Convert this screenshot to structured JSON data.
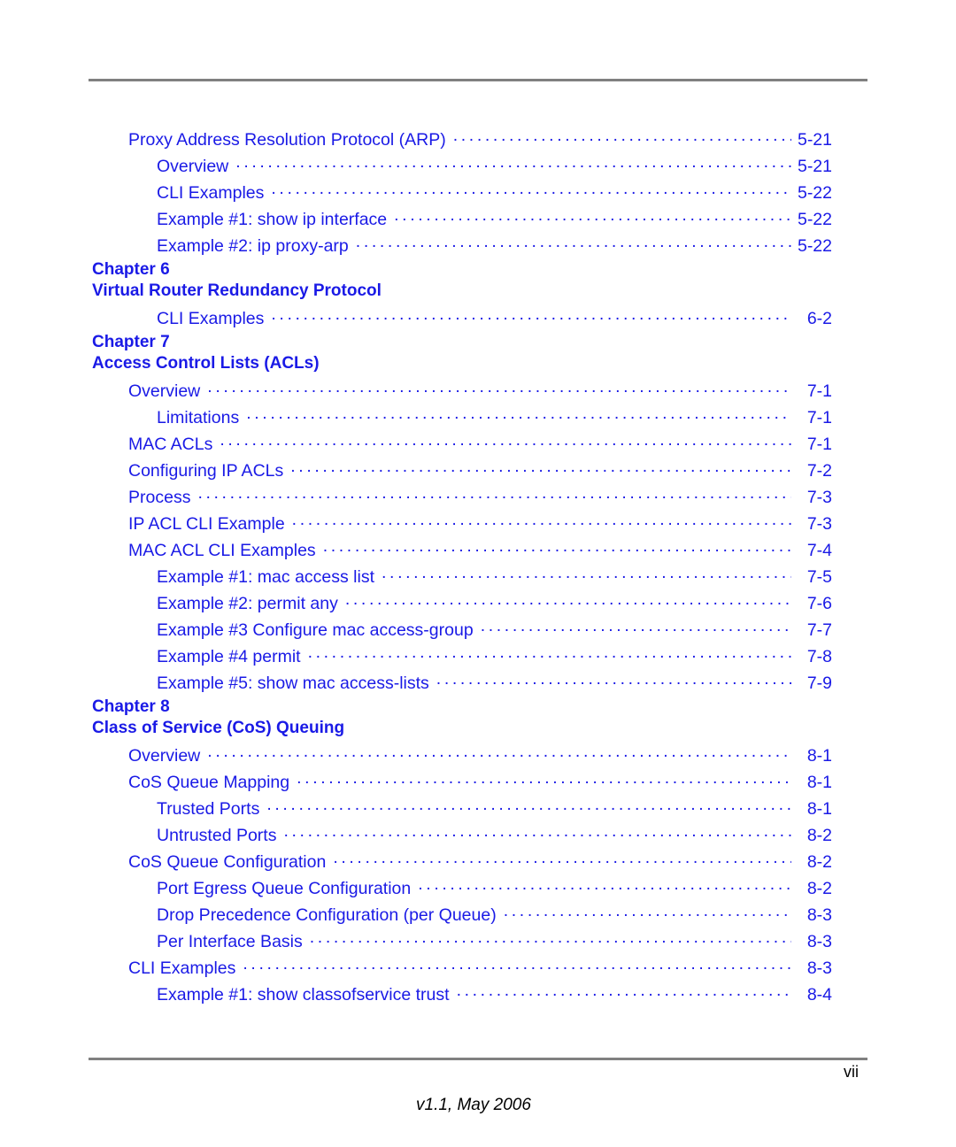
{
  "document": {
    "footer_page_number": "vii",
    "footer_version": "v1.1, May 2006",
    "accent_color": "#1a1ae6",
    "rule_color": "#808080"
  },
  "toc": {
    "blocks": [
      {
        "kind": "entries",
        "entries": [
          {
            "level": 1,
            "label": "Proxy Address Resolution Protocol (ARP)",
            "page": "5-21"
          },
          {
            "level": 2,
            "label": "Overview",
            "page": "5-21"
          },
          {
            "level": 2,
            "label": "CLI Examples",
            "page": "5-22"
          },
          {
            "level": 3,
            "label": "Example #1: show ip interface",
            "page": "5-22"
          },
          {
            "level": 3,
            "label": "Example #2: ip proxy-arp",
            "page": "5-22"
          }
        ]
      },
      {
        "kind": "chapter",
        "number": "Chapter 6",
        "title": "Virtual Router Redundancy Protocol",
        "entries": [
          {
            "level": 2,
            "label": "CLI Examples",
            "page": "6-2"
          }
        ]
      },
      {
        "kind": "chapter",
        "number": "Chapter 7",
        "title": "Access Control Lists (ACLs)",
        "entries": [
          {
            "level": 1,
            "label": "Overview",
            "page": "7-1"
          },
          {
            "level": 2,
            "label": "Limitations",
            "page": "7-1"
          },
          {
            "level": 1,
            "label": "MAC ACLs",
            "page": "7-1"
          },
          {
            "level": 1,
            "label": "Configuring IP ACLs",
            "page": "7-2"
          },
          {
            "level": 1,
            "label": "Process",
            "page": "7-3"
          },
          {
            "level": 1,
            "label": "IP ACL CLI Example",
            "page": "7-3"
          },
          {
            "level": 1,
            "label": "MAC ACL CLI Examples",
            "page": "7-4"
          },
          {
            "level": 2,
            "label": "Example #1: mac access list",
            "page": "7-5"
          },
          {
            "level": 2,
            "label": "Example #2: permit any",
            "page": "7-6"
          },
          {
            "level": 2,
            "label": "Example #3 Configure mac access-group",
            "page": "7-7"
          },
          {
            "level": 2,
            "label": "Example #4 permit",
            "page": "7-8"
          },
          {
            "level": 2,
            "label": "Example #5: show mac access-lists",
            "page": "7-9"
          }
        ]
      },
      {
        "kind": "chapter",
        "number": "Chapter 8",
        "title": "Class of Service (CoS) Queuing",
        "entries": [
          {
            "level": 1,
            "label": "Overview",
            "page": "8-1"
          },
          {
            "level": 1,
            "label": "CoS Queue Mapping",
            "page": "8-1"
          },
          {
            "level": 2,
            "label": "Trusted Ports",
            "page": "8-1"
          },
          {
            "level": 2,
            "label": "Untrusted Ports",
            "page": "8-2"
          },
          {
            "level": 1,
            "label": "CoS Queue Configuration",
            "page": "8-2"
          },
          {
            "level": 2,
            "label": "Port Egress Queue Configuration",
            "page": "8-2"
          },
          {
            "level": 2,
            "label": "Drop Precedence Configuration (per Queue)",
            "page": "8-3"
          },
          {
            "level": 2,
            "label": "Per Interface Basis",
            "page": "8-3"
          },
          {
            "level": 1,
            "label": "CLI Examples",
            "page": "8-3"
          },
          {
            "level": 2,
            "label": "Example #1: show classofservice trust",
            "page": "8-4"
          }
        ]
      }
    ]
  }
}
